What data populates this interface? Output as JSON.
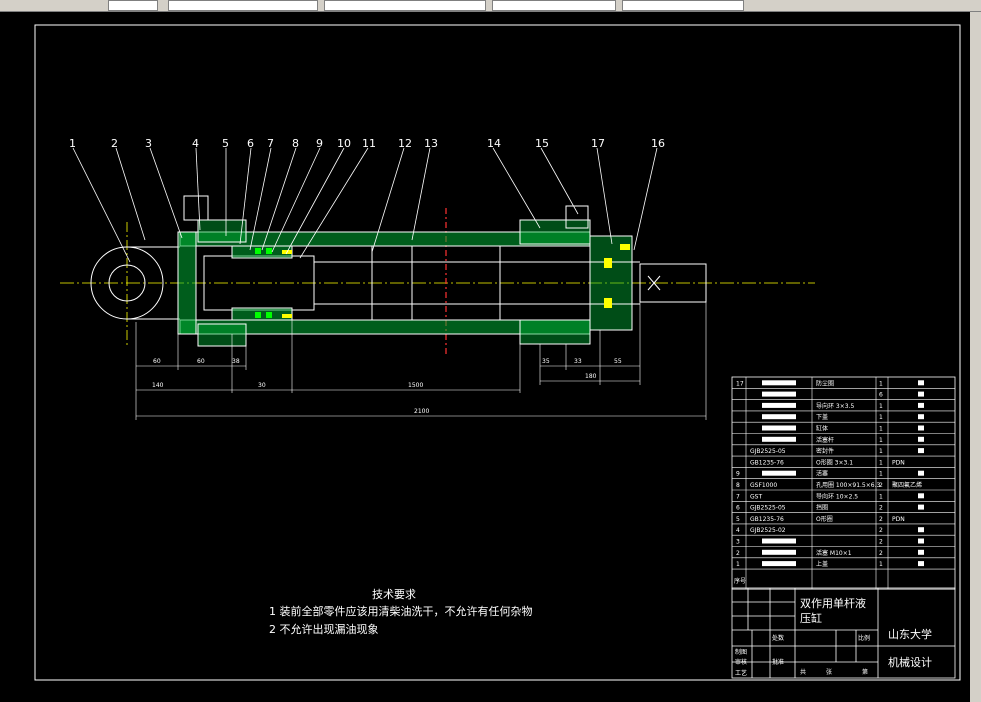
{
  "balloons": [
    "1",
    "2",
    "3",
    "4",
    "5",
    "6",
    "7",
    "8",
    "9",
    "10",
    "11",
    "12",
    "13",
    "14",
    "15",
    "16",
    "17"
  ],
  "dimensions": {
    "d60a": "60",
    "d60b": "60",
    "d38": "38",
    "d140": "140",
    "d30": "30",
    "d1500": "1500",
    "d2100": "2100",
    "d35": "35",
    "d33": "33",
    "d55": "55",
    "d180": "180"
  },
  "tech_requirements": {
    "title": "技术要求",
    "item1": "1  装前全部零件应该用清柴油洗干，不允许有任何杂物",
    "item2": "2  不允许出现漏油现象"
  },
  "bom": {
    "rows": [
      {
        "no": "17",
        "code": "",
        "name": "防尘圈",
        "qty": "1",
        "mat": ""
      },
      {
        "no": "",
        "code": "",
        "name": "",
        "qty": "6",
        "mat": ""
      },
      {
        "no": "",
        "code": "",
        "name": "导向环 3×3.5",
        "qty": "1",
        "mat": ""
      },
      {
        "no": "",
        "code": "",
        "name": "下盖",
        "qty": "1",
        "mat": ""
      },
      {
        "no": "",
        "code": "",
        "name": "缸体",
        "qty": "1",
        "mat": ""
      },
      {
        "no": "",
        "code": "",
        "name": "活塞杆",
        "qty": "1",
        "mat": ""
      },
      {
        "no": "",
        "code": "GJB2525-05",
        "name": "密封件",
        "qty": "1",
        "mat": ""
      },
      {
        "no": "",
        "code": "GB1235-76",
        "name": "O形圈 3×3.1",
        "qty": "1",
        "mat": "PDN"
      },
      {
        "no": "9",
        "code": "",
        "name": "活塞",
        "qty": "1",
        "mat": ""
      },
      {
        "no": "8",
        "code": "GSF1000",
        "name": "孔用圈 100×91.5×6.3",
        "qty": "2",
        "mat": "聚四氟乙烯"
      },
      {
        "no": "7",
        "code": "GST",
        "name": "导向环 10×2.5",
        "qty": "1",
        "mat": ""
      },
      {
        "no": "6",
        "code": "GJB2525-05",
        "name": "挡圈",
        "qty": "2",
        "mat": ""
      },
      {
        "no": "5",
        "code": "GB1235-76",
        "name": "O形圈",
        "qty": "2",
        "mat": "PDN"
      },
      {
        "no": "4",
        "code": "GJB2525-02",
        "name": "",
        "qty": "2",
        "mat": ""
      },
      {
        "no": "3",
        "code": "",
        "name": "",
        "qty": "2",
        "mat": ""
      },
      {
        "no": "2",
        "code": "",
        "name": "活塞 M10×1",
        "qty": "2",
        "mat": ""
      },
      {
        "no": "1",
        "code": "",
        "name": "上盖",
        "qty": "1",
        "mat": ""
      }
    ],
    "header_label": "序号"
  },
  "title_block": {
    "drawing_title": "双作用单杆液压缸",
    "university": "山东大学",
    "course": "机械设计",
    "labels": {
      "zhitu": "制图",
      "shenhe": "审核",
      "gongyi": "工艺",
      "pizhun": "批准",
      "dahao": "处数",
      "biaoji": "标记",
      "bili": "比例",
      "zhong": "共",
      "zhang": "张",
      "di": "第"
    }
  },
  "colors": {
    "background": "#000000",
    "lines": "#ffffff",
    "hatch": "#00cc00",
    "center": "#ffff00",
    "section": "#ff3333",
    "seal": "#ffff00",
    "gseal": "#00ff00"
  }
}
